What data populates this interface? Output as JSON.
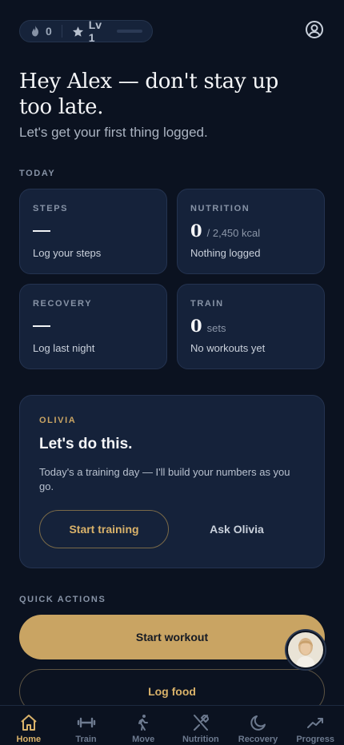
{
  "header": {
    "streak_count": "0",
    "level_label": "Lv 1",
    "xp_progress": 0.0
  },
  "greeting": {
    "title": "Hey Alex — don't stay up too late.",
    "subtitle": "Let's get your first thing logged."
  },
  "today": {
    "section_label": "TODAY",
    "cards": [
      {
        "label": "STEPS",
        "value": "",
        "unit": "",
        "note": "Log your steps"
      },
      {
        "label": "NUTRITION",
        "value": "0",
        "unit": "/ 2,450 kcal",
        "note": "Nothing logged"
      },
      {
        "label": "RECOVERY",
        "value": "",
        "unit": "",
        "note": "Log last night"
      },
      {
        "label": "TRAIN",
        "value": "0",
        "unit": "sets",
        "note": "No workouts yet"
      }
    ]
  },
  "coach": {
    "name": "OLIVIA",
    "headline": "Let's do this.",
    "message": "Today's a training day — I'll build your numbers as you go.",
    "primary_action": "Start training",
    "secondary_action": "Ask Olivia"
  },
  "quick_actions": {
    "section_label": "QUICK ACTIONS",
    "primary": "Start workout",
    "secondary": "Log food"
  },
  "tabs": [
    {
      "label": "Home",
      "icon": "home-icon",
      "active": true
    },
    {
      "label": "Train",
      "icon": "dumbbell-icon",
      "active": false
    },
    {
      "label": "Move",
      "icon": "walking-icon",
      "active": false
    },
    {
      "label": "Nutrition",
      "icon": "utensils-icon",
      "active": false
    },
    {
      "label": "Recovery",
      "icon": "moon-icon",
      "active": false
    },
    {
      "label": "Progress",
      "icon": "trend-icon",
      "active": false
    }
  ],
  "colors": {
    "background": "#0b1220",
    "card": "#15223a",
    "accent_gold": "#c9a463"
  }
}
